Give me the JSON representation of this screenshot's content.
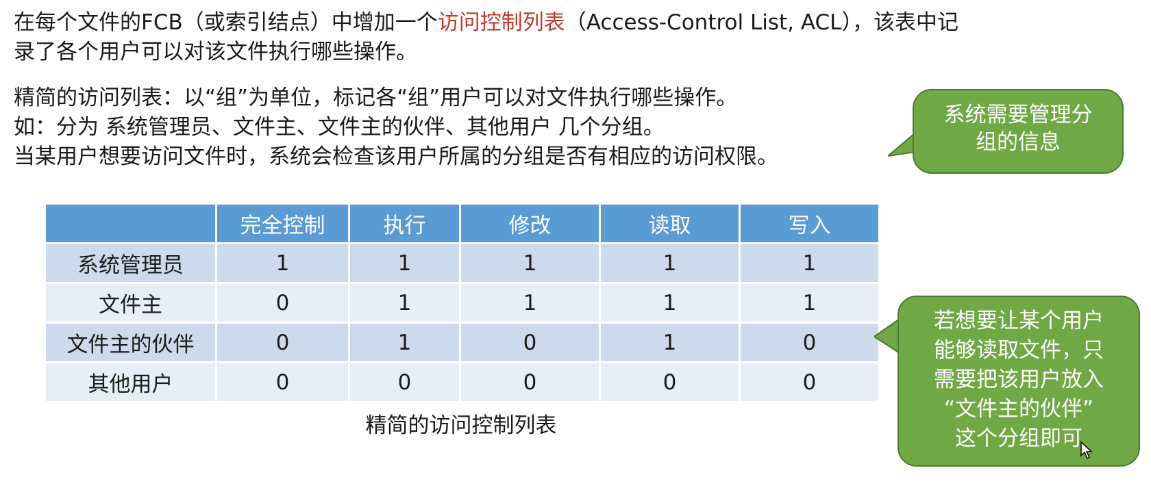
{
  "intro": {
    "part1": "在每个文件的FCB（或索引结点）中增加一个",
    "highlight": "访问控制列表",
    "part2": "（Access-Control List, ACL），该表中记",
    "line2": "录了各个用户可以对该文件执行哪些操作。"
  },
  "simplified": {
    "line1": "精简的访问列表：以“组”为单位，标记各“组”用户可以对文件执行哪些操作。",
    "line2": "如：分为 系统管理员、文件主、文件主的伙伴、其他用户 几个分组。",
    "line3": "当某用户想要访问文件时，系统会检查该用户所属的分组是否有相应的访问权限。"
  },
  "table": {
    "corner": "",
    "headers": [
      "完全控制",
      "执行",
      "修改",
      "读取",
      "写入"
    ],
    "rows": [
      {
        "group": "系统管理员",
        "values": [
          "1",
          "1",
          "1",
          "1",
          "1"
        ]
      },
      {
        "group": "文件主",
        "values": [
          "0",
          "1",
          "1",
          "1",
          "1"
        ]
      },
      {
        "group": "文件主的伙伴",
        "values": [
          "0",
          "1",
          "0",
          "1",
          "0"
        ]
      },
      {
        "group": "其他用户",
        "values": [
          "0",
          "0",
          "0",
          "0",
          "0"
        ]
      }
    ],
    "caption": "精简的访问控制列表"
  },
  "callouts": {
    "top": [
      "系统需要管理分",
      "组的信息"
    ],
    "bottom": [
      "若想要让某个用户",
      "能够读取文件，只",
      "需要把该用户放入",
      "“文件主的伙伴”",
      "这个分组即可"
    ]
  },
  "colors": {
    "highlight": "#c0392b",
    "header_bg": "#5b9bd5",
    "row_dark": "#ccdaeb",
    "row_light": "#e8eef7",
    "callout_bg": "#70a845"
  }
}
